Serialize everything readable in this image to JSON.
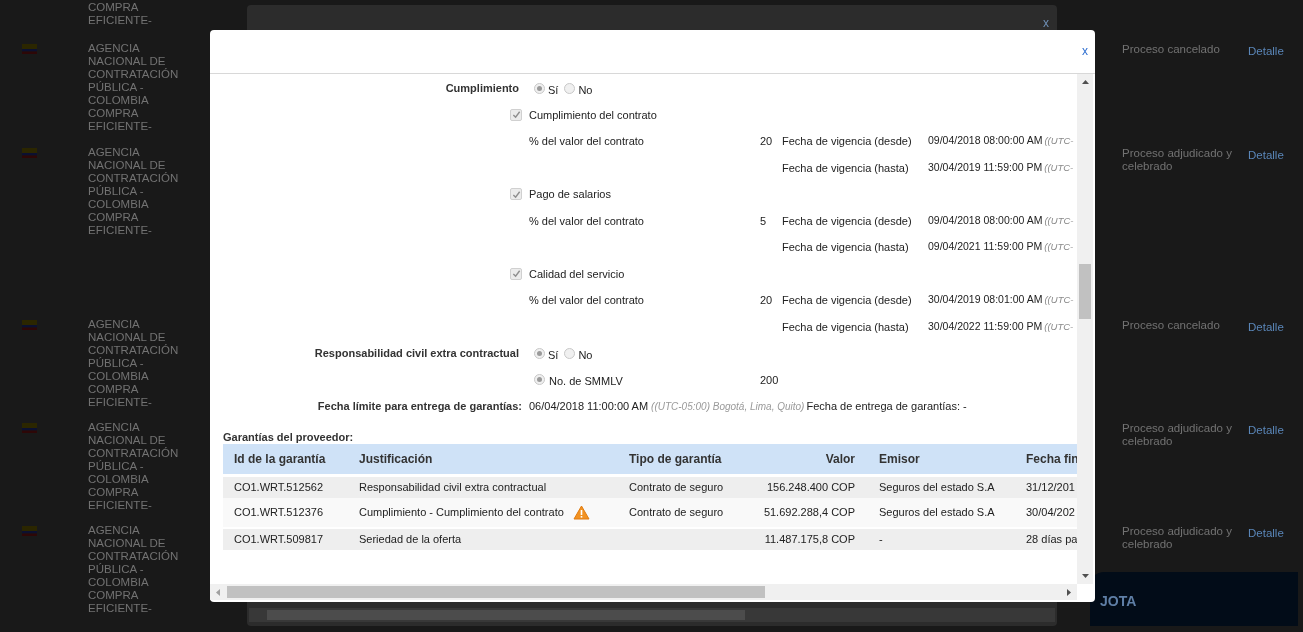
{
  "background_rows": [
    {
      "agency": "COMPRA EFICIENTE-",
      "flag": false
    },
    {
      "agency": "AGENCIA NACIONAL DE CONTRATACIÓN PÚBLICA - COLOMBIA COMPRA EFICIENTE-",
      "flag": true,
      "status": "Proceso cancelado",
      "link": "Detalle"
    },
    {
      "agency": "AGENCIA NACIONAL DE CONTRATACIÓN PÚBLICA - COLOMBIA COMPRA EFICIENTE-",
      "flag": true,
      "status": "Proceso adjudicado y celebrado",
      "link": "Detalle"
    },
    {
      "agency": "AGENCIA NACIONAL DE CONTRATACIÓN PÚBLICA - COLOMBIA COMPRA EFICIENTE-",
      "flag": true,
      "status": "Proceso cancelado",
      "link": "Detalle"
    },
    {
      "agency": "AGENCIA NACIONAL DE CONTRATACIÓN PÚBLICA - COLOMBIA COMPRA EFICIENTE-",
      "flag": true,
      "status": "Proceso adjudicado y celebrado",
      "link": "Detalle"
    },
    {
      "agency": "AGENCIA NACIONAL DE CONTRATACIÓN PÚBLICA - COLOMBIA COMPRA EFICIENTE-",
      "flag": true,
      "status": "Proceso adjudicado y celebrado",
      "link": "Detalle"
    }
  ],
  "background_banner": {
    "text": "JOTA"
  },
  "back_dialog": {
    "close": "x"
  },
  "dialog": {
    "close": "x",
    "form": [
      {
        "kind": "radio",
        "label": "Cumplimiento",
        "options": [
          {
            "label": "Sí",
            "selected": true
          },
          {
            "label": "No",
            "selected": false
          }
        ]
      },
      {
        "kind": "check",
        "label": "Cumplimiento del contrato",
        "checked": true
      },
      {
        "kind": "percent",
        "label": "% del valor del contrato",
        "value": "20",
        "field_label": "Fecha de vigencia (desde)",
        "date": "09/04/2018 08:00:00 AM",
        "timezone": "((UTC-"
      },
      {
        "kind": "until",
        "field_label": "Fecha de vigencia (hasta)",
        "date": "30/04/2019 11:59:00 PM",
        "timezone": "((UTC-"
      },
      {
        "kind": "check",
        "label": "Pago de salarios",
        "checked": true
      },
      {
        "kind": "percent",
        "label": "% del valor del contrato",
        "value": "5",
        "field_label": "Fecha de vigencia (desde)",
        "date": "09/04/2018 08:00:00 AM",
        "timezone": "((UTC-"
      },
      {
        "kind": "until",
        "field_label": "Fecha de vigencia (hasta)",
        "date": "09/04/2021 11:59:00 PM",
        "timezone": "((UTC-"
      },
      {
        "kind": "check",
        "label": "Calidad del servicio",
        "checked": true
      },
      {
        "kind": "percent",
        "label": "% del valor del contrato",
        "value": "20",
        "field_label": "Fecha de vigencia (desde)",
        "date": "30/04/2019 08:01:00 AM",
        "timezone": "((UTC-"
      },
      {
        "kind": "until",
        "field_label": "Fecha de vigencia (hasta)",
        "date": "30/04/2022 11:59:00 PM",
        "timezone": "((UTC-"
      },
      {
        "kind": "radio",
        "label": "Responsabilidad civil extra contractual",
        "options": [
          {
            "label": "Sí",
            "selected": true
          },
          {
            "label": "No",
            "selected": false
          }
        ]
      },
      {
        "kind": "option",
        "label": "No. de SMMLV",
        "selected": true,
        "value": "200"
      },
      {
        "kind": "deadline",
        "label": "Fecha límite para entrega de garantías:",
        "date": "06/04/2018 11:00:00 AM",
        "timezone": "((UTC-05:00) Bogotá, Lima, Quito)",
        "delivery": "Fecha de entrega de garantías: -"
      }
    ],
    "guarantees": {
      "title": "Garantías del proveedor:",
      "columns": [
        "Id de la garantía",
        "Justificación",
        "Tipo de garantía",
        "Valor",
        "Emisor",
        "Fecha fin"
      ],
      "rows": [
        {
          "cells": [
            "CO1.WRT.512562",
            "Responsabilidad civil extra contractual",
            "Contrato de seguro",
            "156.248.400 COP",
            "Seguros del estado S.A",
            "31/12/201"
          ],
          "warning": false
        },
        {
          "cells": [
            "CO1.WRT.512376",
            "Cumplimiento - Cumplimiento del contrato",
            "Contrato de seguro",
            "51.692.288,4 COP",
            "Seguros del estado S.A",
            "30/04/202"
          ],
          "warning": true
        },
        {
          "cells": [
            "CO1.WRT.509817",
            "Seriedad de la oferta",
            "",
            "11.487.175,8 COP",
            "-",
            "28 días pa"
          ],
          "warning": false
        }
      ]
    }
  }
}
